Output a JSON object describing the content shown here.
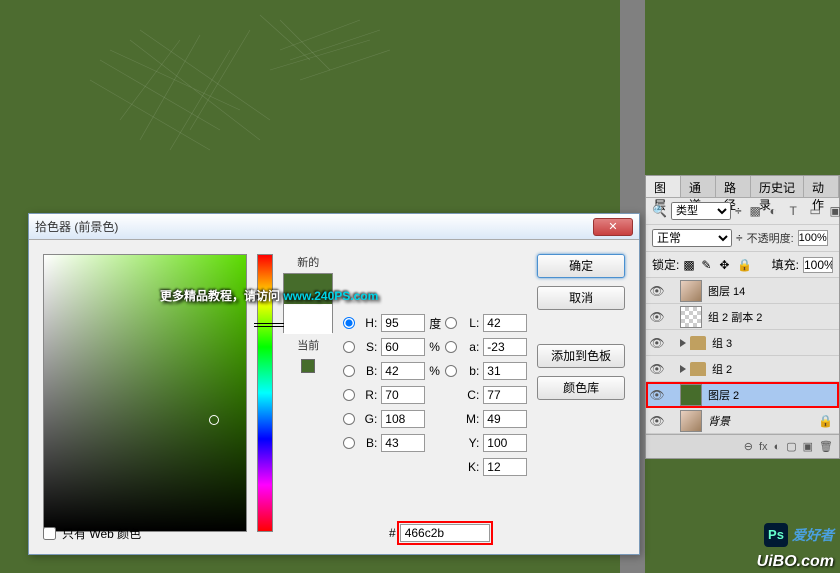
{
  "canvas": {
    "bg_color": "#4d6c30"
  },
  "watermark": {
    "text_prefix": "更多精品教程，请访问 ",
    "link": "www.240PS.com"
  },
  "corner": {
    "logo": "Ps",
    "text1": "爱好者",
    "uibo": "UiBO.com"
  },
  "layers_panel": {
    "tabs": [
      "图层",
      "通道",
      "路径",
      "历史记录",
      "动作"
    ],
    "active_tab": 0,
    "filter_type": "类型",
    "blend_mode": "正常",
    "opacity_label": "不透明度:",
    "opacity_value": "100%",
    "lock_label": "锁定:",
    "fill_label": "填充:",
    "fill_value": "100%",
    "layers": [
      {
        "name": "图层 14",
        "thumb": "img",
        "visible": true
      },
      {
        "name": "组 2 副本 2",
        "thumb": "checker",
        "visible": true
      },
      {
        "name": "组 3",
        "folder": true,
        "visible": true
      },
      {
        "name": "组 2",
        "folder": true,
        "visible": true
      },
      {
        "name": "图层 2",
        "thumb": "green",
        "visible": true,
        "selected": true,
        "highlighted": true
      },
      {
        "name": "背景",
        "thumb": "img",
        "visible": true,
        "locked": true,
        "italic": true
      }
    ],
    "footer_icons": [
      "⊖",
      "fx",
      "◐",
      "▢",
      "▣",
      "🗑"
    ]
  },
  "color_picker": {
    "title": "拾色器 (前景色)",
    "new_label": "新的",
    "current_label": "当前",
    "ok": "确定",
    "cancel": "取消",
    "add_swatch": "添加到色板",
    "color_lib": "颜色库",
    "hsb": {
      "h_label": "H:",
      "h_val": "95",
      "h_unit": "度",
      "s_label": "S:",
      "s_val": "60",
      "s_unit": "%",
      "b_label": "B:",
      "b_val": "42",
      "b_unit": "%"
    },
    "rgb": {
      "r_label": "R:",
      "r_val": "70",
      "g_label": "G:",
      "g_val": "108",
      "b_label": "B:",
      "b_val": "43"
    },
    "lab": {
      "l_label": "L:",
      "l_val": "42",
      "a_label": "a:",
      "a_val": "-23",
      "b_label": "b:",
      "b_val": "31"
    },
    "cmyk": {
      "c_label": "C:",
      "c_val": "77",
      "m_label": "M:",
      "m_val": "49",
      "y_label": "Y:",
      "y_val": "100",
      "k_label": "K:",
      "k_val": "12",
      "unit": "%"
    },
    "web_only": "只有 Web 颜色",
    "hex_prefix": "#",
    "hex_value": "466c2b",
    "new_color": "#466c2b",
    "cur_color": "#ffffff"
  }
}
